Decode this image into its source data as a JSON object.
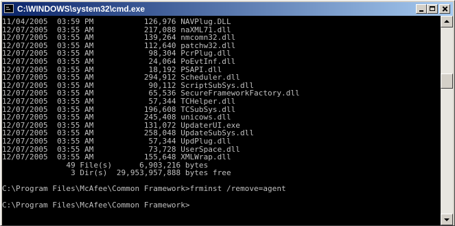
{
  "window": {
    "title": "C:\\WINDOWS\\system32\\cmd.exe",
    "minimize_label": "",
    "maximize_label": "",
    "close_label": ""
  },
  "console": {
    "lines": [
      "11/04/2005  03:59 PM           126,976 NAVPlug.DLL",
      "12/07/2005  03:55 AM           217,088 naXML71.dll",
      "12/07/2005  03:55 AM           139,264 nmcomn32.dll",
      "12/07/2005  03:55 AM           112,640 patchw32.dll",
      "12/07/2005  03:55 AM            98,304 PcrPlug.dll",
      "12/07/2005  03:55 AM            24,064 PoEvtInf.dll",
      "12/07/2005  03:55 AM            18,192 PSAPI.dll",
      "12/07/2005  03:55 AM           294,912 Scheduler.dll",
      "12/07/2005  03:55 AM            90,112 ScriptSubSys.dll",
      "12/07/2005  03:55 AM            65,536 SecureFrameworkFactory.dll",
      "12/07/2005  03:55 AM            57,344 TCHelper.dll",
      "12/07/2005  03:55 AM           196,608 TCSubSys.dll",
      "12/07/2005  03:55 AM           245,408 unicows.dll",
      "12/07/2005  03:55 AM           131,072 UpdaterUI.exe",
      "12/07/2005  03:55 AM           258,048 UpdateSubSys.dll",
      "12/07/2005  03:55 AM            57,344 UpdPlug.dll",
      "12/07/2005  03:55 AM            73,728 UserSpace.dll",
      "12/07/2005  03:55 AM           155,648 XMLWrap.dll",
      "              49 File(s)      6,903,216 bytes",
      "               3 Dir(s)  29,953,957,888 bytes free",
      "",
      "C:\\Program Files\\McAfee\\Common Framework>frminst /remove=agent",
      "",
      "C:\\Program Files\\McAfee\\Common Framework>"
    ]
  },
  "scrollbar": {
    "position_fraction": 0.27
  }
}
